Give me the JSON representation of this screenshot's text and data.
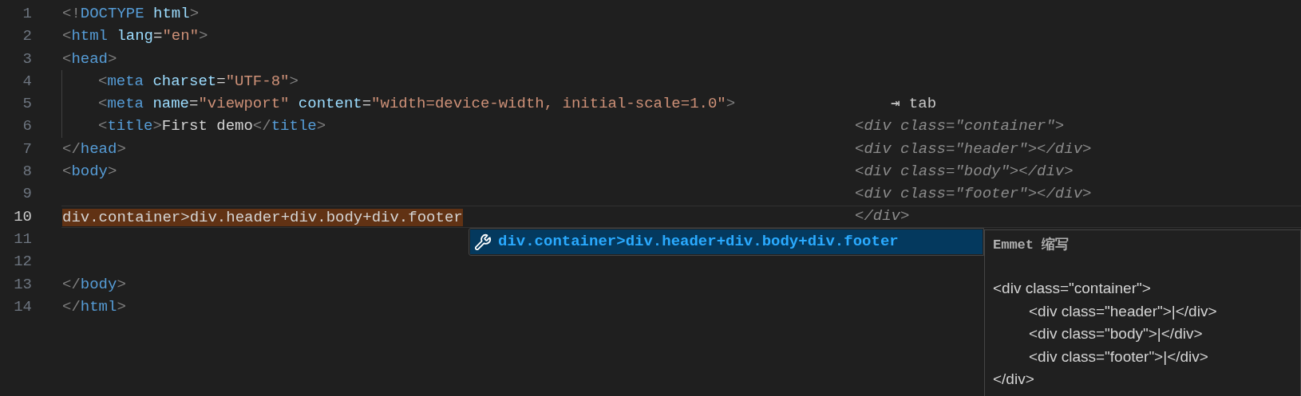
{
  "editor": {
    "lines": [
      {
        "number": "1",
        "current": false,
        "tokens": [
          {
            "kind": "punct",
            "text": "<!"
          },
          {
            "kind": "tag",
            "text": "DOCTYPE"
          },
          {
            "kind": "attr",
            "text": " html"
          },
          {
            "kind": "punct",
            "text": ">"
          }
        ]
      },
      {
        "number": "2",
        "current": false,
        "tokens": [
          {
            "kind": "punct",
            "text": "<"
          },
          {
            "kind": "tag",
            "text": "html"
          },
          {
            "kind": "attr",
            "text": " lang"
          },
          {
            "kind": "text",
            "text": "="
          },
          {
            "kind": "string",
            "text": "\"en\""
          },
          {
            "kind": "punct",
            "text": ">"
          }
        ]
      },
      {
        "number": "3",
        "current": false,
        "tokens": [
          {
            "kind": "punct",
            "text": "<"
          },
          {
            "kind": "tag",
            "text": "head"
          },
          {
            "kind": "punct",
            "text": ">"
          }
        ]
      },
      {
        "number": "4",
        "indented": true,
        "current": false,
        "tokens": [
          {
            "kind": "punct",
            "text": "<"
          },
          {
            "kind": "tag",
            "text": "meta"
          },
          {
            "kind": "attr",
            "text": " charset"
          },
          {
            "kind": "text",
            "text": "="
          },
          {
            "kind": "string",
            "text": "\"UTF-8\""
          },
          {
            "kind": "punct",
            "text": ">"
          }
        ]
      },
      {
        "number": "5",
        "indented": true,
        "current": false,
        "tokens": [
          {
            "kind": "punct",
            "text": "<"
          },
          {
            "kind": "tag",
            "text": "meta"
          },
          {
            "kind": "attr",
            "text": " name"
          },
          {
            "kind": "text",
            "text": "="
          },
          {
            "kind": "string",
            "text": "\"viewport\""
          },
          {
            "kind": "attr",
            "text": " content"
          },
          {
            "kind": "text",
            "text": "="
          },
          {
            "kind": "string",
            "text": "\"width=device-width, initial-scale=1.0\""
          },
          {
            "kind": "punct",
            "text": ">"
          }
        ]
      },
      {
        "number": "6",
        "indented": true,
        "current": false,
        "tokens": [
          {
            "kind": "punct",
            "text": "<"
          },
          {
            "kind": "tag",
            "text": "title"
          },
          {
            "kind": "punct",
            "text": ">"
          },
          {
            "kind": "text",
            "text": "First demo"
          },
          {
            "kind": "punct",
            "text": "</"
          },
          {
            "kind": "tag",
            "text": "title"
          },
          {
            "kind": "punct",
            "text": ">"
          }
        ]
      },
      {
        "number": "7",
        "current": false,
        "tokens": [
          {
            "kind": "punct",
            "text": "</"
          },
          {
            "kind": "tag",
            "text": "head"
          },
          {
            "kind": "punct",
            "text": ">"
          }
        ]
      },
      {
        "number": "8",
        "current": false,
        "tokens": [
          {
            "kind": "punct",
            "text": "<"
          },
          {
            "kind": "tag",
            "text": "body"
          },
          {
            "kind": "punct",
            "text": ">"
          }
        ]
      },
      {
        "number": "9",
        "current": false
      },
      {
        "number": "10",
        "current": true,
        "tokens": [
          {
            "kind": "abbreviation",
            "text": "div.container>div.header+div.body+div.footer"
          }
        ]
      },
      {
        "number": "11",
        "current": false
      },
      {
        "number": "12",
        "current": false
      },
      {
        "number": "13",
        "current": false,
        "tokens": [
          {
            "kind": "punct",
            "text": "</"
          },
          {
            "kind": "tag",
            "text": "body"
          },
          {
            "kind": "punct",
            "text": ">"
          }
        ]
      },
      {
        "number": "14",
        "current": false,
        "tokens": [
          {
            "kind": "punct",
            "text": "</"
          },
          {
            "kind": "tag",
            "text": "html"
          },
          {
            "kind": "punct",
            "text": ">"
          }
        ]
      }
    ]
  },
  "ghost_preview": {
    "hint": "⇥ tab",
    "lines": [
      "<div class=\"container\">",
      "<div class=\"header\"></div>",
      "<div class=\"body\"></div>",
      "<div class=\"footer\"></div>",
      "</div>"
    ]
  },
  "suggestion": {
    "label": "div.container>div.header+div.body+div.footer",
    "selected": true
  },
  "details": {
    "title": "Emmet 缩写",
    "lines": [
      {
        "text": "<div class=\"container\">",
        "indented": false
      },
      {
        "text": "<div class=\"header\">|</div>",
        "indented": true
      },
      {
        "text": "<div class=\"body\">|</div>",
        "indented": true
      },
      {
        "text": "<div class=\"footer\">|</div>",
        "indented": true
      },
      {
        "text": "</div>",
        "indented": false
      }
    ]
  }
}
